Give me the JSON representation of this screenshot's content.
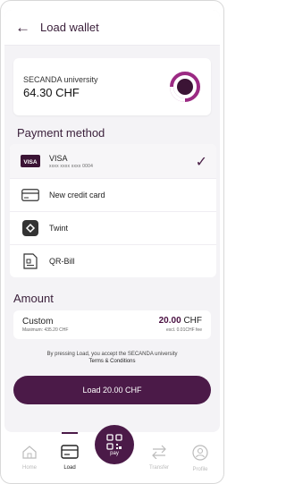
{
  "header": {
    "title": "Load wallet",
    "back_icon": "arrow-left-icon"
  },
  "account": {
    "name": "SECANDA university",
    "balance": "64.30 CHF",
    "logo_icon": "secanda-logo-icon",
    "colors": {
      "logo_outer": "#9b2a83",
      "logo_inner": "#3b1435"
    }
  },
  "payment": {
    "title": "Payment method",
    "methods": [
      {
        "label": "VISA",
        "sub": "xxxx xxxx xxxx 0004",
        "icon": "visa-card-icon",
        "selected": true
      },
      {
        "label": "New credit card",
        "icon": "credit-card-icon",
        "selected": false
      },
      {
        "label": "Twint",
        "icon": "twint-icon",
        "selected": false
      },
      {
        "label": "QR-Bill",
        "icon": "qr-bill-icon",
        "selected": false
      }
    ]
  },
  "amount": {
    "title": "Amount",
    "custom_label": "Custom",
    "max_label": "Maximum: 435.20 CHF",
    "value": "20.00",
    "currency": "CHF",
    "fee_note": "excl. 0.01CHF fee"
  },
  "terms": {
    "text": "By pressing Load, you accept the SECANDA university",
    "link": "Terms & Conditions"
  },
  "load_button": "Load 20.00 CHF",
  "nav": {
    "home": "Home",
    "load": "Load",
    "pay": "pay",
    "transfer": "Transfer",
    "profile": "Profile"
  },
  "colors": {
    "accent": "#4b1a48",
    "background": "#f4f3f6"
  }
}
